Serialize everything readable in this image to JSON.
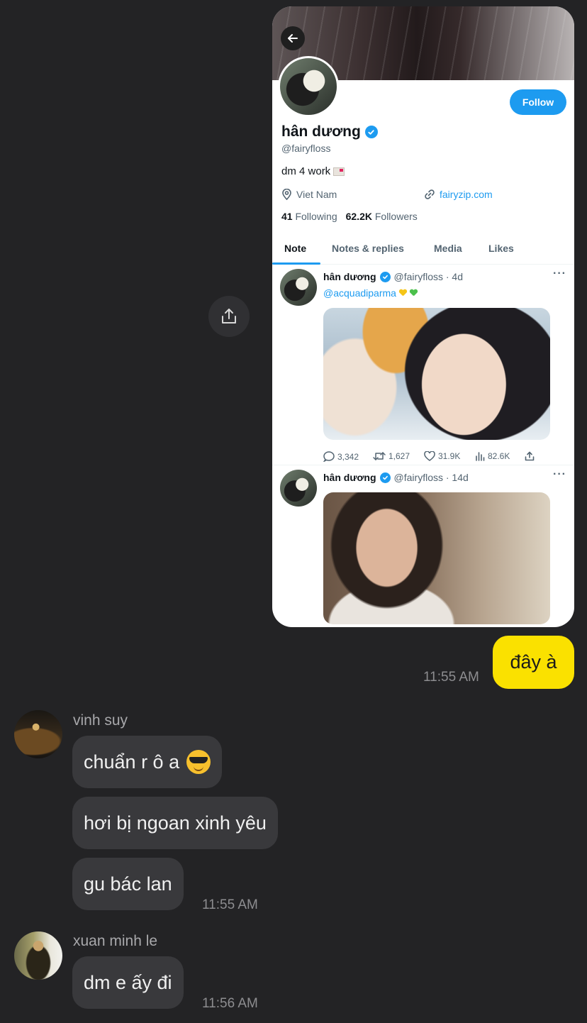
{
  "profile": {
    "display_name": "hân dương",
    "handle": "@fairyfloss",
    "bio": "dm 4 work",
    "location": "Viet Nam",
    "website": "fairyzip.com",
    "following_count": "41",
    "following_label": "Following",
    "followers_count": "62.2K",
    "followers_label": "Followers",
    "follow_label": "Follow"
  },
  "tabs": [
    "Note",
    "Notes & replies",
    "Media",
    "Likes"
  ],
  "tweets": [
    {
      "name": "hân dương",
      "meta": "@fairyfloss · 4d",
      "mention": "@acquadiparma",
      "replies": "3,342",
      "retweets": "1,627",
      "likes": "31.9K",
      "views": "82.6K"
    },
    {
      "name": "hân dương",
      "meta": "@fairyfloss · 14d"
    }
  ],
  "chat": {
    "outgoing": {
      "text": "đây à",
      "time": "11:55 AM"
    },
    "group1": {
      "sender": "vinh suy",
      "messages": [
        "chuẩn r ô a",
        "hơi bị ngoan xinh yêu",
        "gu bác lan"
      ],
      "time": "11:55 AM"
    },
    "group2": {
      "sender": "xuan minh le",
      "messages": [
        "dm e ấy đi"
      ],
      "time": "11:56 AM"
    }
  },
  "icons": {
    "share": "share-icon",
    "back": "arrow-left-icon",
    "location": "map-pin-icon",
    "link": "link-icon",
    "verified": "verified-badge-icon"
  },
  "colors": {
    "background": "#232325",
    "outgoing_bubble": "#fae100",
    "incoming_bubble": "#39393c",
    "twitter_blue": "#1d9bf0"
  }
}
